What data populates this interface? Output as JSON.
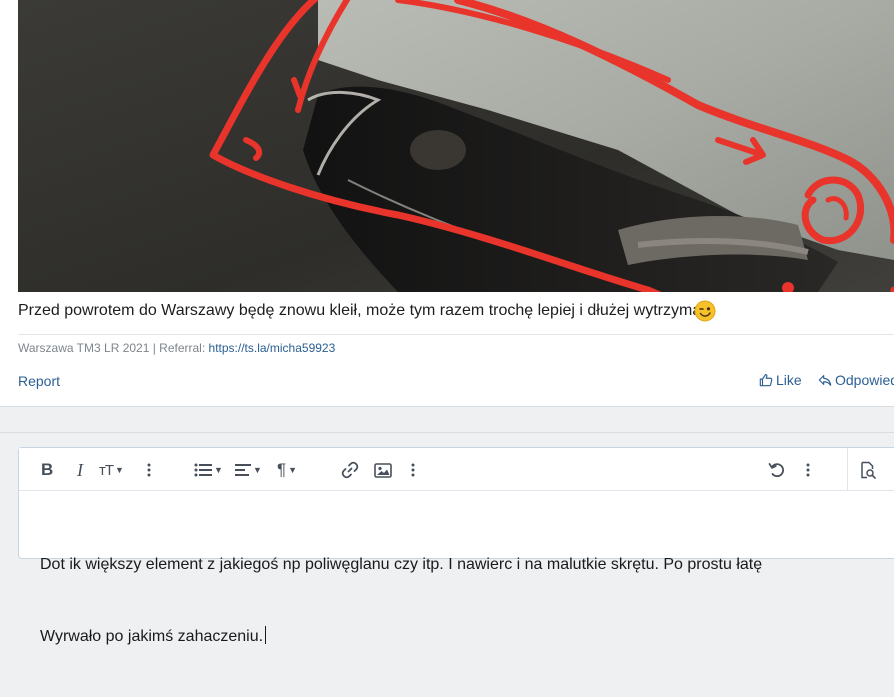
{
  "post": {
    "caption": "Przed powrotem do Warszawy będę znowu kleił, może tym razem trochę lepiej i dłużej wytrzyma",
    "signature_prefix": "Warszawa TM3 LR 2021 | Referral: ",
    "signature_link": "https://ts.la/micha59923",
    "report_label": "Report",
    "like_label": "Like",
    "reply_label": "Odpowiedz",
    "emoji": "winking-face"
  },
  "editor": {
    "toolbar": {
      "bold": "B",
      "italic": "I",
      "font_size": "тT"
    },
    "lines": [
      "Dot ik większy element z jakiegoś np poliwęglanu czy itp. I nawierc i na malutkie skrętu. Po prostu łatę",
      "Wyrwało po jakimś zahaczeniu."
    ]
  },
  "colors": {
    "link": "#2b5f93",
    "annotation": "#e8342a"
  }
}
